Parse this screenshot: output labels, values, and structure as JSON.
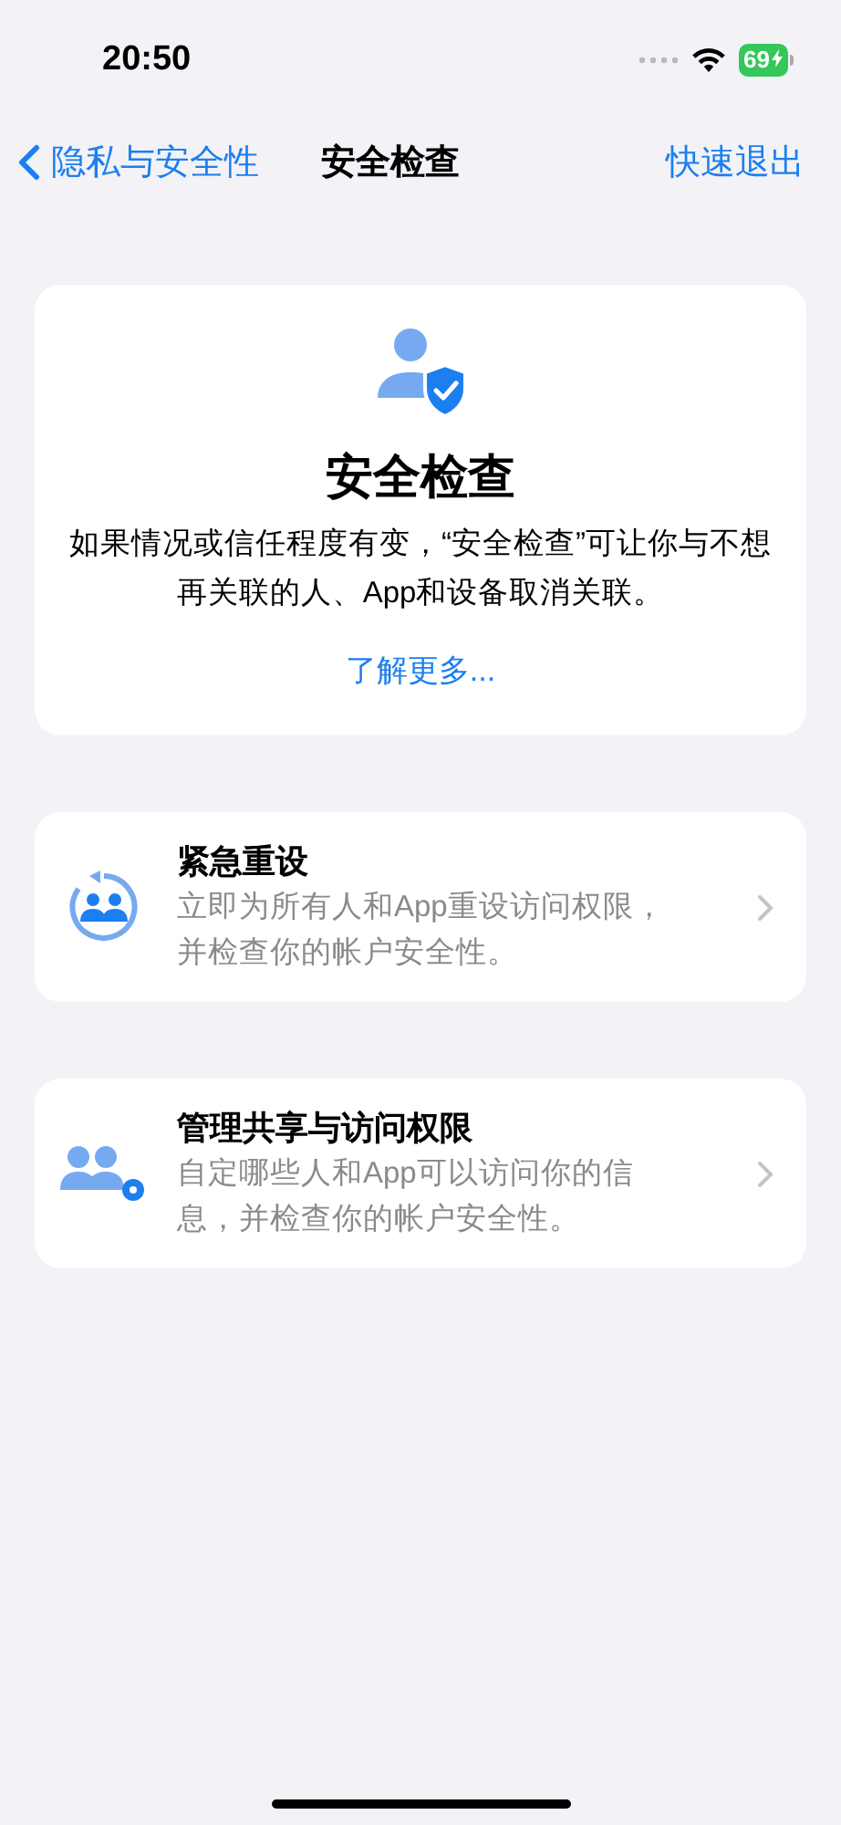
{
  "status_bar": {
    "time": "20:50",
    "battery": "69"
  },
  "nav": {
    "back": "隐私与安全性",
    "title": "安全检查",
    "action": "快速退出"
  },
  "intro": {
    "title": "安全检查",
    "description": "如果情况或信任程度有变，“安全检查”可让你与不想再关联的人、App和设备取消关联。",
    "link": "了解更多..."
  },
  "options": [
    {
      "kind": "reset",
      "title": "紧急重设",
      "description": "立即为所有人和App重设访问权限，并检查你的帐户安全性。"
    },
    {
      "kind": "sharing",
      "title": "管理共享与访问权限",
      "description": "自定哪些人和App可以访问你的信息，并检查你的帐户安全性。"
    }
  ]
}
